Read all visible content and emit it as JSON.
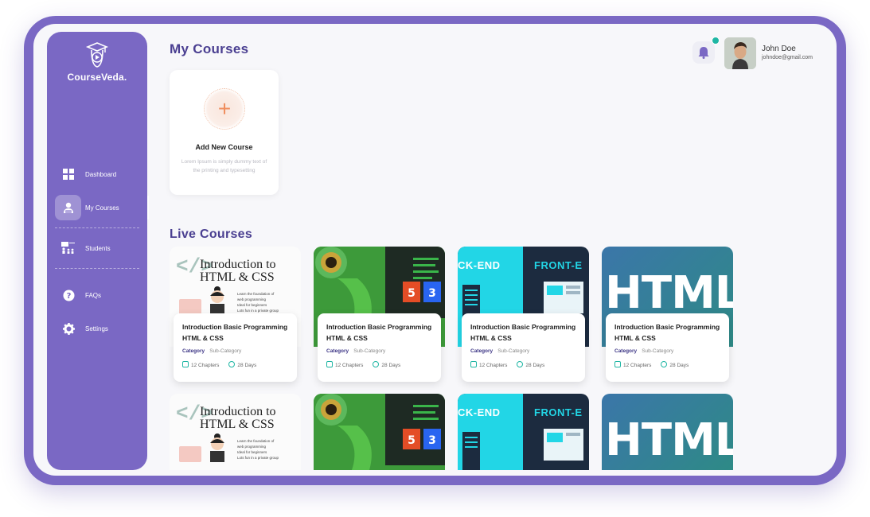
{
  "app": {
    "name": "CourseVeda."
  },
  "sidebar": {
    "items": [
      {
        "label": "Dashboard",
        "icon": "grid-icon"
      },
      {
        "label": "My Courses",
        "icon": "student-icon",
        "active": true
      },
      {
        "label": "Students",
        "icon": "classroom-icon"
      },
      {
        "label": "FAQs",
        "icon": "question-icon"
      },
      {
        "label": "Settings",
        "icon": "gear-icon"
      }
    ]
  },
  "header": {
    "title": "My Courses",
    "user": {
      "name": "John Doe",
      "email": "johndoe@gmail.com"
    }
  },
  "add_course": {
    "title": "Add New Course",
    "description": "Lorem Ipsum is simply dummy text of the printing and typesetting"
  },
  "live_courses": {
    "title": "Live Courses",
    "cards": [
      {
        "title": "Introduction Basic Programming HTML & CSS",
        "category": "Category",
        "subcategory": "Sub-Category",
        "chapters": "12 Chapters",
        "days": "28 Days"
      },
      {
        "title": "Introduction Basic Programming HTML & CSS",
        "category": "Category",
        "subcategory": "Sub-Category",
        "chapters": "12 Chapters",
        "days": "28 Days"
      },
      {
        "title": "Introduction Basic Programming HTML & CSS",
        "category": "Category",
        "subcategory": "Sub-Category",
        "chapters": "12 Chapters",
        "days": "28 Days"
      },
      {
        "title": "Introduction Basic Programming HTML & CSS",
        "category": "Category",
        "subcategory": "Sub-Category",
        "chapters": "12 Chapters",
        "days": "28 Days"
      }
    ]
  },
  "thumbs": {
    "intro_heading_1": "Introduction to",
    "intro_heading_2": "HTML & CSS",
    "intro_bullets": [
      "Learn the foundation of",
      "web programming",
      "Ideal for beginners",
      "Lots fun in a private group"
    ],
    "backend": "CK-END",
    "frontend": "FRONT-E",
    "html": "HTML"
  },
  "colors": {
    "brand": "#7a68c4",
    "title": "#4a3f91",
    "accent": "#1fb6a4",
    "plus": "#f08d5d"
  }
}
